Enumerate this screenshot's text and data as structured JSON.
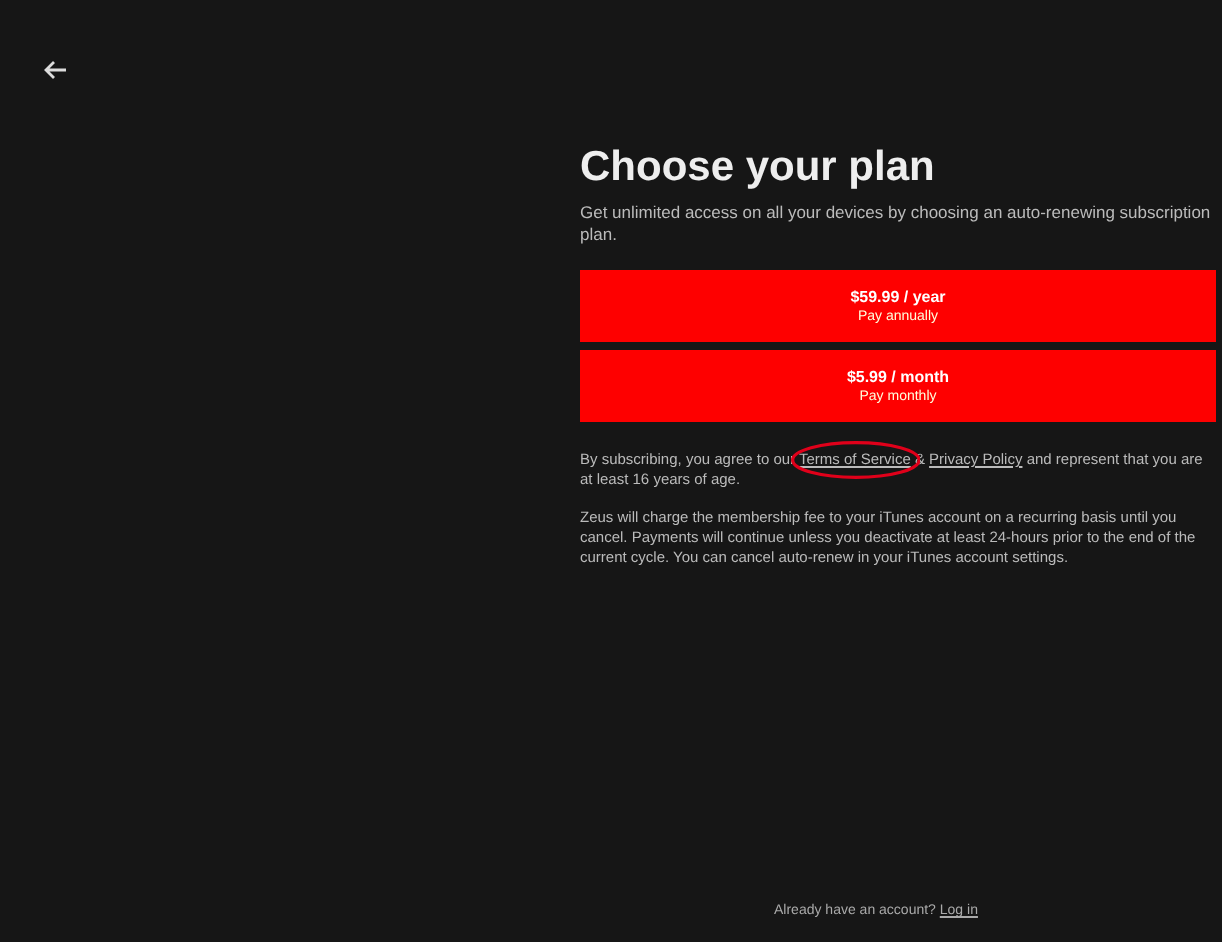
{
  "title": "Choose your plan",
  "subtitle": "Get unlimited access on all your devices by choosing an auto-renewing subscription plan.",
  "plans": [
    {
      "price": "$59.99 / year",
      "note": "Pay annually"
    },
    {
      "price": "$5.99 / month",
      "note": "Pay monthly"
    }
  ],
  "terms": {
    "before": "By subscribing, you agree to our",
    "link_1": "Terms of Service",
    "middle": "&",
    "link_2": "Privacy Policy",
    "after": "and represent that you are at least 16 years of age.",
    "link_1_circled": true
  },
  "disclaimer": "Zeus will charge the membership fee to your iTunes account on a recurring basis until you cancel. Payments will continue unless you deactivate at least 24-hours prior to the end of the current cycle. You can cancel auto-renew in your iTunes account settings.",
  "footer": {
    "text": "Already have an account?",
    "link": "Log in"
  }
}
